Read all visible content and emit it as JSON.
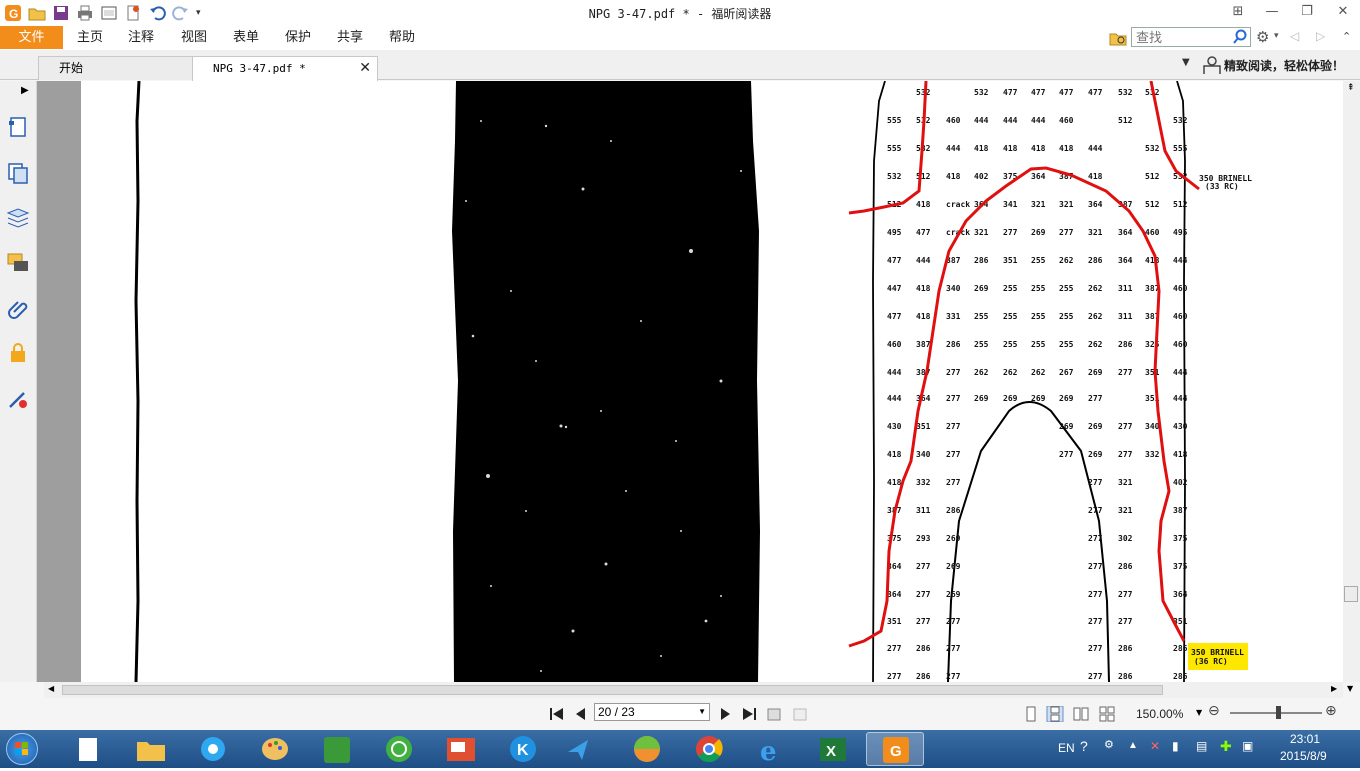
{
  "window": {
    "title": "NPG 3-47.pdf * - 福昕阅读器"
  },
  "menu": {
    "file": "文件",
    "items": [
      "主页",
      "注释",
      "视图",
      "表单",
      "保护",
      "共享",
      "帮助"
    ]
  },
  "search": {
    "placeholder": "查找"
  },
  "tabs": [
    {
      "label": "开始"
    },
    {
      "label": "NPG 3-47.pdf *"
    }
  ],
  "promo": {
    "text": "精致阅读，轻松体验！"
  },
  "document": {
    "annotation_top": [
      "350 BRINELL",
      "(33 RC)"
    ],
    "annotation_bottom": [
      "350 BRINELL",
      "(36 RC)"
    ],
    "rows": [
      [
        "532",
        "532",
        "477",
        "477",
        "477",
        "477",
        "532",
        "532"
      ],
      [
        "555",
        "532",
        "460",
        "444",
        "444",
        "444",
        "460",
        "512",
        "532"
      ],
      [
        "555",
        "532",
        "444",
        "418",
        "418",
        "418",
        "418",
        "444",
        "532",
        "555"
      ],
      [
        "532",
        "512",
        "418",
        "402",
        "375",
        "364",
        "387",
        "418",
        "512",
        "532"
      ],
      [
        "512",
        "418",
        "crack",
        "364",
        "341",
        "321",
        "321",
        "364",
        "387",
        "512",
        "512"
      ],
      [
        "495",
        "477",
        "crack",
        "321",
        "277",
        "269",
        "277",
        "321",
        "364",
        "460",
        "495"
      ],
      [
        "477",
        "444",
        "387",
        "286",
        "351",
        "255",
        "262",
        "286",
        "364",
        "418",
        "444"
      ],
      [
        "447",
        "418",
        "340",
        "269",
        "255",
        "255",
        "255",
        "262",
        "311",
        "387",
        "460"
      ],
      [
        "477",
        "418",
        "331",
        "255",
        "255",
        "255",
        "255",
        "262",
        "311",
        "387",
        "460"
      ],
      [
        "460",
        "387",
        "286",
        "255",
        "255",
        "255",
        "255",
        "262",
        "286",
        "325",
        "460"
      ],
      [
        "444",
        "387",
        "277",
        "262",
        "262",
        "262",
        "267",
        "269",
        "277",
        "351",
        "444"
      ],
      [
        "444",
        "364",
        "277",
        "269",
        "269",
        "269",
        "269",
        "277",
        "351",
        "444"
      ],
      [
        "430",
        "351",
        "277",
        "269",
        "269",
        "277",
        "340",
        "430"
      ],
      [
        "418",
        "340",
        "277",
        "277",
        "269",
        "277",
        "332",
        "418"
      ],
      [
        "418",
        "332",
        "277",
        "277",
        "321",
        "402"
      ],
      [
        "387",
        "311",
        "286",
        "277",
        "321",
        "387"
      ],
      [
        "375",
        "293",
        "269",
        "277",
        "302",
        "375"
      ],
      [
        "364",
        "277",
        "269",
        "277",
        "286",
        "375"
      ],
      [
        "364",
        "277",
        "269",
        "277",
        "277",
        "364"
      ],
      [
        "351",
        "277",
        "277",
        "277",
        "277",
        "351"
      ],
      [
        "277",
        "286",
        "277",
        "277",
        "286",
        "286"
      ],
      [
        "277",
        "286",
        "277",
        "277",
        "286",
        "286"
      ]
    ]
  },
  "nav": {
    "page": "20 / 23",
    "zoom": "150.00%"
  },
  "taskbar": {
    "lang": "EN",
    "time": "23:01",
    "date": "2015/8/9"
  },
  "colors": {
    "accent": "#f28c1a",
    "annotation": "#e01010",
    "highlight": "#ffe800"
  }
}
